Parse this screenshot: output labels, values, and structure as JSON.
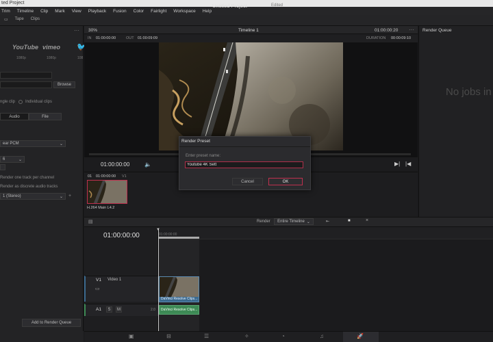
{
  "window": {
    "title": "ted Project"
  },
  "menu": [
    "Trim",
    "Timeline",
    "Clip",
    "Mark",
    "View",
    "Playback",
    "Fusion",
    "Color",
    "Fairlight",
    "Workspace",
    "Help"
  ],
  "header": {
    "tabs": [
      "Tape",
      "Clips"
    ],
    "project_title": "Untitled Project",
    "project_status": "Edited"
  },
  "left": {
    "presets": [
      {
        "name": "YouTube",
        "sub": "1080p"
      },
      {
        "name": "vimeo",
        "sub": "1080p"
      },
      {
        "name": "",
        "sub": "108"
      }
    ],
    "browse_label": "Browse",
    "clip_options": [
      "ngle clip",
      "Individual clips"
    ],
    "tabs": [
      "Audio",
      "File"
    ],
    "codec": "ear PCM",
    "bitdepth": "6",
    "opt_track_per_channel": "Render one track per channel",
    "opt_discrete_audio": "Render as discrete audio tracks",
    "channel_select": "1 (Stereo)",
    "add_to_queue": "Add to Render Queue"
  },
  "viewer": {
    "zoom": "30%",
    "timeline_name": "Timeline 1",
    "timecode_top": "01:00:00:20",
    "in_label": "IN",
    "in_time": "01:00:00:00",
    "out_label": "OUT",
    "out_time": "01:00:09:09",
    "duration_label": "DURATION",
    "duration_time": "00:00:09:10",
    "current_time": "01:00:00:00"
  },
  "render_queue": {
    "title": "Render Queue",
    "empty_text": "No jobs in"
  },
  "clip_strip": {
    "index": "01",
    "timecode": "01:00:00:00",
    "track": "V1",
    "clip_name": "H.264 Main L4.2"
  },
  "timeline": {
    "render_label": "Render",
    "render_select": "Entire Timeline",
    "timecode": "01:00:00:00",
    "ruler_label": "01:00:00:00",
    "v1": {
      "id": "V1",
      "name": "Video 1"
    },
    "a1": {
      "id": "A1",
      "s": "S",
      "m": "M",
      "level": "2.0"
    },
    "video_clip": "DaVinci Resolve Clips...",
    "audio_clip": "DaVinci Resolve Clips..."
  },
  "dialog": {
    "title": "Render Preset",
    "label": "Enter preset name:",
    "value": "Youtube 4K Sett",
    "cancel": "Cancel",
    "ok": "OK"
  },
  "colors": {
    "accent_red": "#c0304f",
    "video_clip": "#3b6a8f",
    "audio_clip": "#3d8a55"
  }
}
